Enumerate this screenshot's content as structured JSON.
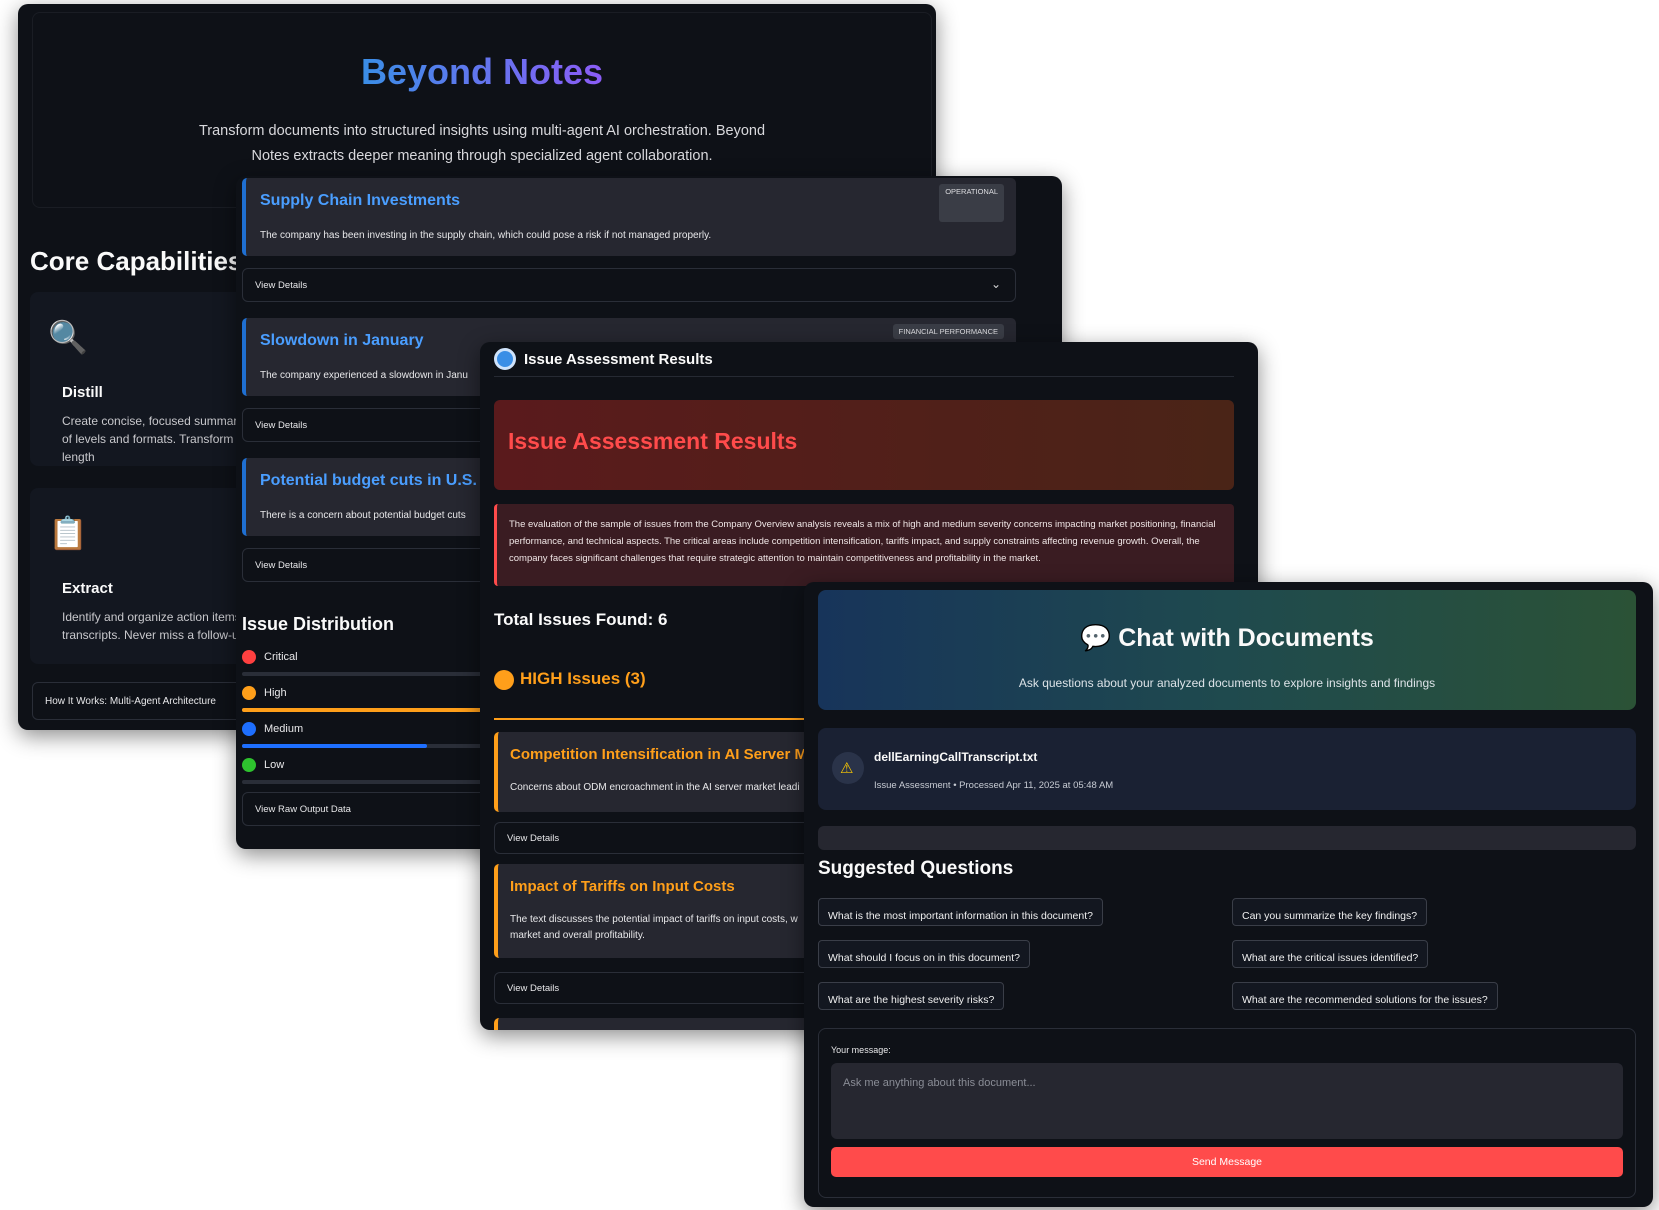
{
  "landing": {
    "title": "Beyond Notes",
    "subtitle": "Transform documents into structured insights using multi-agent AI orchestration. Beyond Notes extracts deeper meaning through specialized agent collaboration.",
    "core_title": "Core Capabilities",
    "capabilities": [
      {
        "icon": "magnifier-icon",
        "glyph": "🔍",
        "name": "Distill",
        "desc": "Create concise, focused summaries of levels and formats. Transform length"
      },
      {
        "icon": "clipboard-icon",
        "glyph": "📋",
        "name": "Extract",
        "desc": "Identify and organize action items, transcripts. Never miss a follow-up"
      }
    ],
    "how_it_works": "How It Works: Multi-Agent Architecture"
  },
  "issues_view": {
    "issues": [
      {
        "title": "Supply Chain Investments",
        "desc": "The company has been investing in the supply chain, which could pose a risk if not managed properly.",
        "category": "OPERATIONAL"
      },
      {
        "title": "Slowdown in January",
        "desc": "The company experienced a slowdown in Janu",
        "category": "FINANCIAL PERFORMANCE"
      },
      {
        "title": "Potential budget cuts in U.S. fe",
        "desc": "There is a concern about potential budget cuts",
        "category": ""
      }
    ],
    "view_details": "View Details",
    "distribution_title": "Issue Distribution",
    "distribution": [
      {
        "label": "Critical",
        "color": "#ff4040",
        "fraction": 0.0
      },
      {
        "label": "High",
        "color": "#ff9f1a",
        "fraction": 1.0
      },
      {
        "label": "Medium",
        "color": "#1e6fff",
        "fraction": 0.44
      },
      {
        "label": "Low",
        "color": "#2ec32e",
        "fraction": 0.0
      }
    ],
    "raw_output": "View Raw Output Data"
  },
  "assessment": {
    "tab_title": "Issue Assessment Results",
    "banner_title": "Issue Assessment Results",
    "summary": "The evaluation of the sample of issues from the Company Overview analysis reveals a mix of high and medium severity concerns impacting market positioning, financial performance, and technical aspects. The critical areas include competition intensification, tariffs impact, and supply constraints affecting revenue growth. Overall, the company faces significant challenges that require strategic attention to maintain competitiveness and profitability in the market.",
    "total": "Total Issues Found: 6",
    "high_header": "HIGH Issues (3)",
    "high_issues": [
      {
        "title": "Competition Intensification in AI Server Ma",
        "desc": "Concerns about ODM encroachment in the AI server market leadi"
      },
      {
        "title": "Impact of Tariffs on Input Costs",
        "desc": "The text discusses the potential impact of tariffs on input costs, w",
        "desc2": "market and overall profitability."
      }
    ],
    "view_details": "View Details"
  },
  "chat": {
    "title": "💬 Chat with Documents",
    "subtitle": "Ask questions about your analyzed documents to explore insights and findings",
    "doc_name": "dellEarningCallTranscript.txt",
    "doc_meta": "Issue Assessment • Processed Apr 11, 2025 at 05:48 AM",
    "doc_icon": "warning-icon",
    "suggested_title": "Suggested Questions",
    "questions": [
      "What is the most important information in this document?",
      "Can you summarize the key findings?",
      "What should I focus on in this document?",
      "What are the critical issues identified?",
      "What are the highest severity risks?",
      "What are the recommended solutions for the issues?"
    ],
    "message_label": "Your message:",
    "message_placeholder": "Ask me anything about this document...",
    "send_label": "Send Message",
    "accent": "#ff4b4b"
  }
}
